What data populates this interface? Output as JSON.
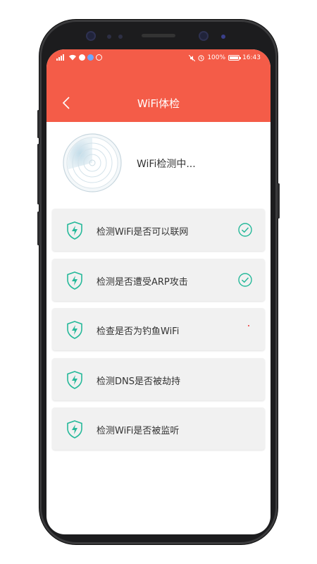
{
  "status_bar": {
    "battery": "100%",
    "time": "16:43"
  },
  "header": {
    "title": "WiFi体检"
  },
  "scan": {
    "status_text": "WiFi检测中..."
  },
  "checks": [
    {
      "label": "检测WiFi是否可以联网",
      "status": "done"
    },
    {
      "label": "检测是否遭受ARP攻击",
      "status": "done"
    },
    {
      "label": "检查是否为钓鱼WiFi",
      "status": "pending"
    },
    {
      "label": "检测DNS是否被劫持",
      "status": "pending"
    },
    {
      "label": "检测WiFi是否被监听",
      "status": "pending"
    }
  ],
  "colors": {
    "header": "#f45c48",
    "accent": "#26b99a",
    "item_bg": "#f1f1f1"
  },
  "icons": {
    "back": "chevron-left-icon",
    "shield": "shield-bolt-icon",
    "check": "check-circle-icon",
    "radar": "radar-icon"
  }
}
